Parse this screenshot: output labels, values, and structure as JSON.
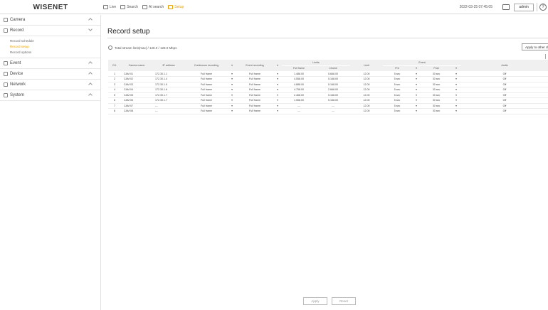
{
  "brand": "WISENET",
  "top_nav": [
    {
      "label": "Live",
      "icon": "monitor-icon",
      "active": false
    },
    {
      "label": "Search",
      "icon": "search-icon",
      "active": false
    },
    {
      "label": "AI search",
      "icon": "ai-search-icon",
      "active": false
    },
    {
      "label": "Setup",
      "icon": "gear-icon",
      "active": true
    }
  ],
  "datetime": "2022-03-25 07:45:05",
  "user": "admin",
  "help": "?",
  "sidebar": {
    "menus": [
      {
        "label": "Camera",
        "icon": "camera-icon",
        "open": false
      },
      {
        "label": "Record",
        "icon": "record-icon",
        "open": true,
        "items": [
          {
            "label": "Record schedule",
            "active": false
          },
          {
            "label": "Record setup",
            "active": true
          },
          {
            "label": "Record options",
            "active": false
          }
        ]
      },
      {
        "label": "Event",
        "icon": "event-icon",
        "open": false
      },
      {
        "label": "Device",
        "icon": "device-icon",
        "open": false
      },
      {
        "label": "Network",
        "icon": "network-icon",
        "open": false
      },
      {
        "label": "System",
        "icon": "system-icon",
        "open": false
      }
    ]
  },
  "main": {
    "title": "Record setup",
    "info": "Total stream limit(max) / 128.0 / 128.0 Mbps",
    "apply_other": "Apply to other channels",
    "headers": {
      "ch": "CH.",
      "name": "Camera name",
      "ip": "IP address",
      "continuous": "Continuous recording",
      "event": "Event recording",
      "limit_group": "Limits",
      "full_frame": "Full frame",
      "iframe": "I-frame",
      "limit": "Limit",
      "event_group": "Event",
      "pre": "Pre",
      "post": "Post",
      "audio": "Audio"
    },
    "rows": [
      {
        "ch": "1",
        "name": "CAM 01",
        "ip": "172.30.1.1",
        "cont": "Full frame",
        "event": "Full frame",
        "full": "1.488.00",
        "iframe": "5.668.00",
        "limit": "12.00",
        "pre": "5 sec",
        "post": "30 sec",
        "audio": "Off"
      },
      {
        "ch": "2",
        "name": "CAM 02",
        "ip": "172.30.1.4",
        "cont": "Full frame",
        "event": "Full frame",
        "full": "4.558.00",
        "iframe": "5.168.00",
        "limit": "12.00",
        "pre": "5 sec",
        "post": "30 sec",
        "audio": "Off"
      },
      {
        "ch": "3",
        "name": "CAM 03",
        "ip": "172.30.1.5",
        "cont": "Full frame",
        "event": "Full frame",
        "full": "4.888.00",
        "iframe": "5.168.00",
        "limit": "12.00",
        "pre": "5 sec",
        "post": "30 sec",
        "audio": "Off"
      },
      {
        "ch": "4",
        "name": "CAM 04",
        "ip": "172.30.1.6",
        "cont": "Full frame",
        "event": "Full frame",
        "full": "4.758.00",
        "iframe": "2.668.00",
        "limit": "12.00",
        "pre": "5 sec",
        "post": "30 sec",
        "audio": "Off"
      },
      {
        "ch": "5",
        "name": "CAM 05",
        "ip": "172.30.1.7",
        "cont": "Full frame",
        "event": "Full frame",
        "full": "2.468.00",
        "iframe": "5.168.00",
        "limit": "12.00",
        "pre": "5 sec",
        "post": "30 sec",
        "audio": "Off"
      },
      {
        "ch": "6",
        "name": "CAM 06",
        "ip": "172.30.1.7",
        "cont": "Full frame",
        "event": "Full frame",
        "full": "1.068.00",
        "iframe": "5.168.00",
        "limit": "12.00",
        "pre": "5 sec",
        "post": "30 sec",
        "audio": "Off"
      },
      {
        "ch": "7",
        "name": "CAM 07",
        "ip": "---",
        "cont": "Full frame",
        "event": "Full frame",
        "full": "---",
        "iframe": "---",
        "limit": "12.00",
        "pre": "5 sec",
        "post": "30 sec",
        "audio": "Off"
      },
      {
        "ch": "8",
        "name": "CAM 08",
        "ip": "---",
        "cont": "Full frame",
        "event": "Full frame",
        "full": "---",
        "iframe": "---",
        "limit": "12.00",
        "pre": "5 sec",
        "post": "30 sec",
        "audio": "Off"
      }
    ],
    "apply_label": "Apply",
    "reset_label": "Reset"
  },
  "colors": {
    "accent": "#e8a200",
    "header_bg": "#f0f0f0"
  }
}
